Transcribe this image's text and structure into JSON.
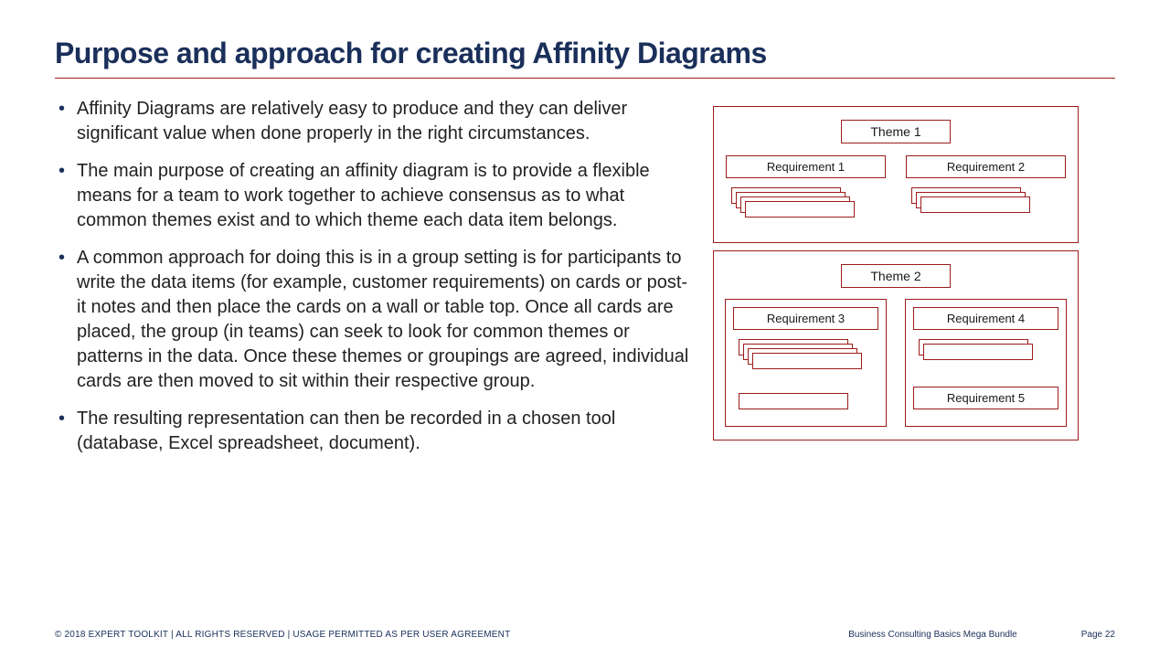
{
  "title": "Purpose and approach for creating Affinity Diagrams",
  "bullets": [
    "Affinity Diagrams are relatively easy to produce and they can deliver significant value when done properly in the right circumstances.",
    "The main purpose of creating an affinity diagram is to provide a flexible means for a team to work together to achieve consensus as to what common themes exist and to which theme each data item belongs.",
    "A common approach for doing this is in a group setting is for participants to write the data items (for example, customer requirements) on cards or post-it notes and then place the cards on a wall or table top. Once all cards are placed, the group (in teams) can seek to look for common themes or patterns in the data. Once these themes or groupings are agreed, individual cards are then moved to sit within their respective group.",
    "The resulting representation can then be recorded in a chosen tool (database, Excel spreadsheet, document)."
  ],
  "diagram": {
    "theme1": {
      "label": "Theme 1",
      "req1": "Requirement 1",
      "req2": "Requirement 2"
    },
    "theme2": {
      "label": "Theme 2",
      "req3": "Requirement 3",
      "req4": "Requirement 4",
      "req5": "Requirement 5"
    }
  },
  "footer": {
    "copyright": "© 2018 EXPERT TOOLKIT | ALL RIGHTS RESERVED | USAGE PERMITTED AS PER USER AGREEMENT",
    "product": "Business Consulting Basics Mega Bundle",
    "page": "Page 22"
  }
}
